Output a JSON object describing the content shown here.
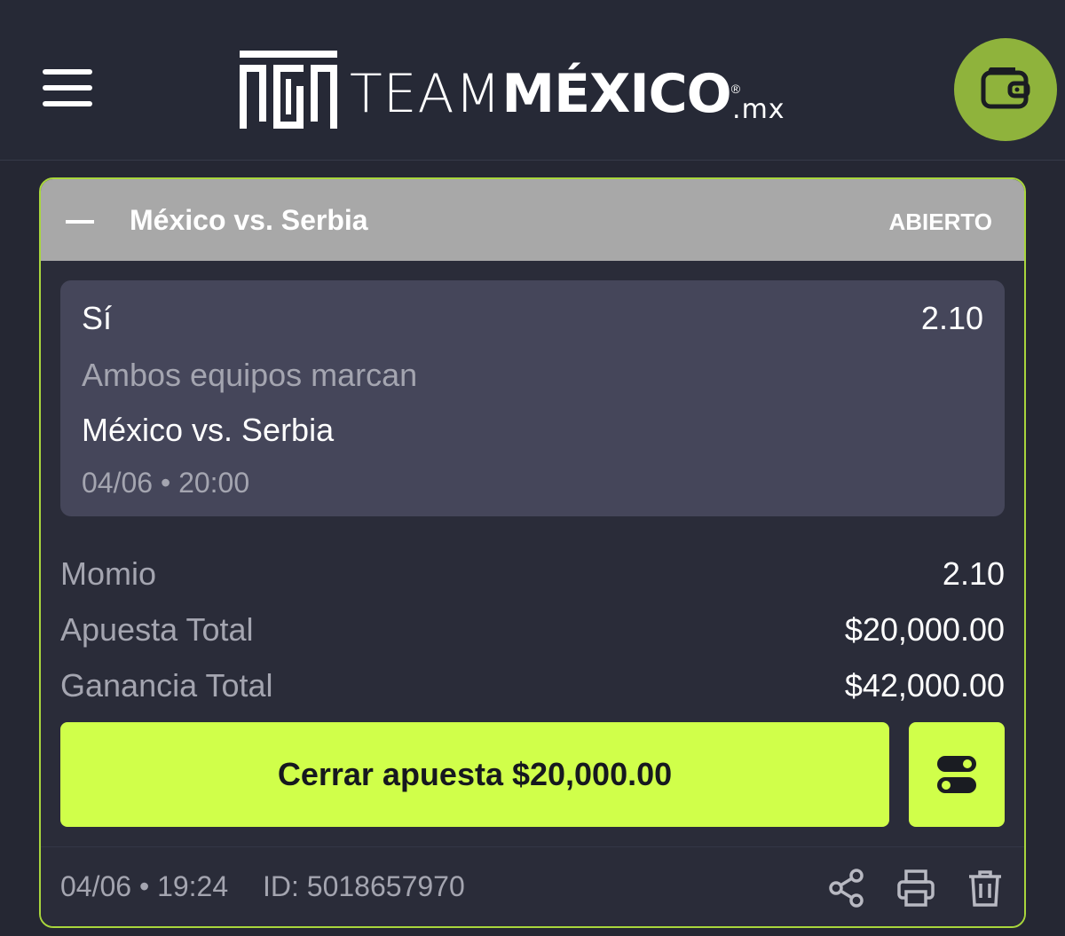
{
  "header": {
    "logo_team": "TEAM",
    "logo_mexico": "MÉXICO",
    "logo_reg": "®",
    "logo_mx": ".mx",
    "menu_icon": "hamburger-menu-icon",
    "wallet_icon": "wallet-icon",
    "wallet_color": "#8fb33c"
  },
  "bet": {
    "title": "México vs. Serbia",
    "status": "ABIERTO",
    "selection": {
      "pick": "Sí",
      "odds": "2.10",
      "market": "Ambos equipos marcan",
      "event": "México vs. Serbia",
      "datetime": "04/06 • 20:00"
    },
    "summary": [
      {
        "label": "Momio",
        "value": "2.10"
      },
      {
        "label": "Apuesta Total",
        "value": "$20,000.00"
      },
      {
        "label": "Ganancia Total",
        "value": "$42,000.00"
      }
    ],
    "cashout_label": "Cerrar apuesta $20,000.00",
    "accent_color": "#d0ff4a",
    "footer": {
      "placed": "04/06 • 19:24",
      "id": "ID: 5018657970",
      "icons": [
        "share-icon",
        "print-icon",
        "trash-icon"
      ]
    }
  }
}
